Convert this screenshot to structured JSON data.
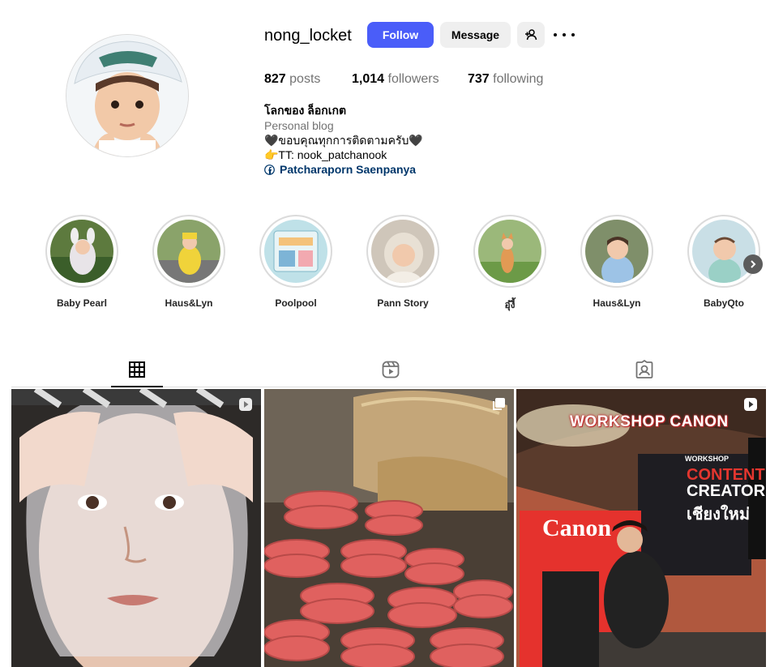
{
  "profile": {
    "username": "nong_locket",
    "follow_label": "Follow",
    "message_label": "Message",
    "posts_count": "827",
    "posts_label": "posts",
    "followers_count": "1,014",
    "followers_label": "followers",
    "following_count": "737",
    "following_label": "following",
    "bio_name": "โลกของ ล็อกเกต",
    "bio_category": "Personal blog",
    "bio_line1": "🖤ขอบคุณทุกการติดตามครับ🖤",
    "bio_line2": "👉TT: nook_patchanook",
    "bio_link": "Patcharaporn Saenpanya"
  },
  "highlights": [
    {
      "label": "Baby Pearl"
    },
    {
      "label": "Haus&Lyn"
    },
    {
      "label": "Poolpool"
    },
    {
      "label": "Pann Story"
    },
    {
      "label": "อุ๋งี้"
    },
    {
      "label": "Haus&Lyn"
    },
    {
      "label": "BabyQto"
    }
  ],
  "tabs": [
    {
      "name": "posts",
      "icon": "grid-icon",
      "active": true
    },
    {
      "name": "reels",
      "icon": "reels-icon",
      "active": false
    },
    {
      "name": "tagged",
      "icon": "tagged-icon",
      "active": false
    }
  ],
  "posts": [
    {
      "type": "reel",
      "badge_icon": "reel-badge-icon",
      "overlay_text": ""
    },
    {
      "type": "carousel",
      "badge_icon": "carousel-badge-icon",
      "overlay_text": ""
    },
    {
      "type": "reel",
      "badge_icon": "reel-badge-icon",
      "overlay_text": "WORKSHOP CANON",
      "screen_small": "WORKSHOP",
      "screen_l1": "CONTENT",
      "screen_l2": "CREATOR",
      "screen_l3": "เชียงใหม่",
      "brand": "Canon"
    }
  ],
  "colors": {
    "accent": "#4a5df9",
    "link": "#00376b",
    "muted": "#737373"
  }
}
